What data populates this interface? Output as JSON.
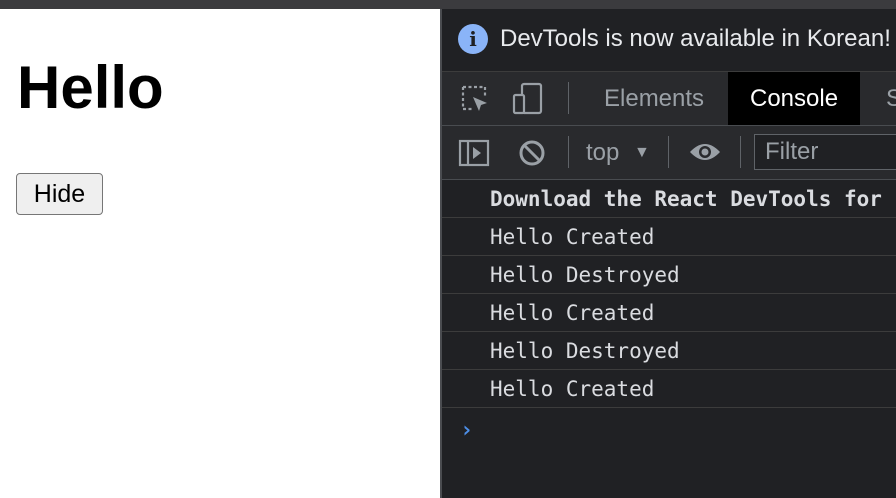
{
  "page": {
    "heading": "Hello",
    "hide_button": "Hide"
  },
  "devtools": {
    "infobar": {
      "icon": "info-icon",
      "text": "DevTools is now available in Korean!"
    },
    "tabs": [
      {
        "label": "Elements",
        "active": false
      },
      {
        "label": "Console",
        "active": true
      },
      {
        "label": "S",
        "active": false
      }
    ],
    "toolbar_icons": [
      "inspect-element-icon",
      "device-toolbar-icon",
      "sidebar-toggle-icon",
      "clear-console-icon",
      "live-expression-icon"
    ],
    "context": {
      "label": "top",
      "arrow": "▼"
    },
    "filter": {
      "placeholder": "Filter",
      "value": ""
    },
    "messages": [
      {
        "text": "Download the React DevTools for",
        "bold": true
      },
      {
        "text": "Hello Created",
        "bold": false
      },
      {
        "text": "Hello Destroyed",
        "bold": false
      },
      {
        "text": "Hello Created",
        "bold": false
      },
      {
        "text": "Hello Destroyed",
        "bold": false
      },
      {
        "text": "Hello Created",
        "bold": false
      }
    ],
    "prompt": "›"
  },
  "colors": {
    "devtools_bg": "#202124",
    "toolbar_bg": "#292a2d",
    "active_tab_bg": "#000000",
    "info_icon": "#8ab4f8",
    "prompt": "#4d8fe8"
  }
}
